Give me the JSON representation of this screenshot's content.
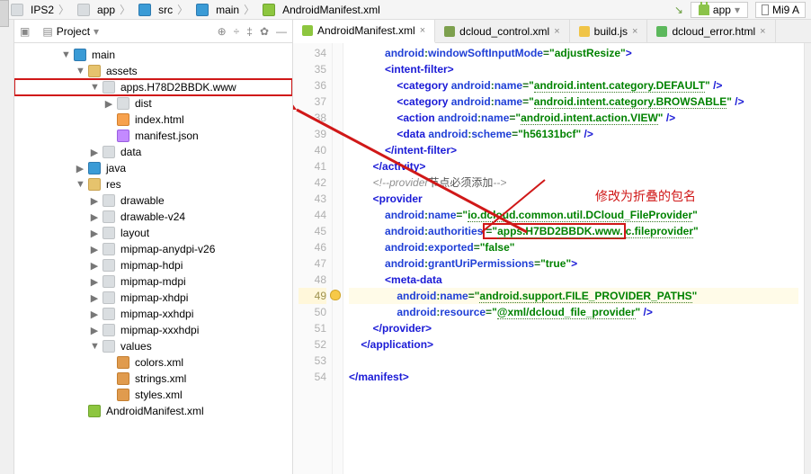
{
  "breadcrumb": [
    "IPS2",
    "app",
    "src",
    "main",
    "AndroidManifest.xml"
  ],
  "breadcrumb_icons": [
    "ico-folder",
    "ico-folder",
    "ico-bluefolder",
    "ico-bluefolder",
    "ico-mf"
  ],
  "topbar": {
    "run_config": "app",
    "device": "Mi9 A"
  },
  "project": {
    "title": "Project",
    "tree": [
      {
        "indent": 3,
        "arrow": "▼",
        "ico": "ico-bluefolder",
        "label": "main",
        "hl": false
      },
      {
        "indent": 4,
        "arrow": "▼",
        "ico": "ico-yellowfolder",
        "label": "assets",
        "hl": false
      },
      {
        "indent": 5,
        "arrow": "▼",
        "ico": "ico-greyfolder",
        "label": "apps.H78D2BBDK.www",
        "hl": true
      },
      {
        "indent": 6,
        "arrow": "▶",
        "ico": "ico-greyfolder",
        "label": "dist",
        "hl": false
      },
      {
        "indent": 6,
        "arrow": "",
        "ico": "ico-html",
        "label": "index.html",
        "hl": false
      },
      {
        "indent": 6,
        "arrow": "",
        "ico": "ico-json",
        "label": "manifest.json",
        "hl": false
      },
      {
        "indent": 5,
        "arrow": "▶",
        "ico": "ico-greyfolder",
        "label": "data",
        "hl": false
      },
      {
        "indent": 4,
        "arrow": "▶",
        "ico": "ico-bluefolder",
        "label": "java",
        "hl": false
      },
      {
        "indent": 4,
        "arrow": "▼",
        "ico": "ico-yellowfolder",
        "label": "res",
        "hl": false
      },
      {
        "indent": 5,
        "arrow": "▶",
        "ico": "ico-greyfolder",
        "label": "drawable",
        "hl": false
      },
      {
        "indent": 5,
        "arrow": "▶",
        "ico": "ico-greyfolder",
        "label": "drawable-v24",
        "hl": false
      },
      {
        "indent": 5,
        "arrow": "▶",
        "ico": "ico-greyfolder",
        "label": "layout",
        "hl": false
      },
      {
        "indent": 5,
        "arrow": "▶",
        "ico": "ico-greyfolder",
        "label": "mipmap-anydpi-v26",
        "hl": false
      },
      {
        "indent": 5,
        "arrow": "▶",
        "ico": "ico-greyfolder",
        "label": "mipmap-hdpi",
        "hl": false
      },
      {
        "indent": 5,
        "arrow": "▶",
        "ico": "ico-greyfolder",
        "label": "mipmap-mdpi",
        "hl": false
      },
      {
        "indent": 5,
        "arrow": "▶",
        "ico": "ico-greyfolder",
        "label": "mipmap-xhdpi",
        "hl": false
      },
      {
        "indent": 5,
        "arrow": "▶",
        "ico": "ico-greyfolder",
        "label": "mipmap-xxhdpi",
        "hl": false
      },
      {
        "indent": 5,
        "arrow": "▶",
        "ico": "ico-greyfolder",
        "label": "mipmap-xxxhdpi",
        "hl": false
      },
      {
        "indent": 5,
        "arrow": "▼",
        "ico": "ico-greyfolder",
        "label": "values",
        "hl": false
      },
      {
        "indent": 6,
        "arrow": "",
        "ico": "ico-xml",
        "label": "colors.xml",
        "hl": false
      },
      {
        "indent": 6,
        "arrow": "",
        "ico": "ico-xml",
        "label": "strings.xml",
        "hl": false
      },
      {
        "indent": 6,
        "arrow": "",
        "ico": "ico-xml",
        "label": "styles.xml",
        "hl": false
      },
      {
        "indent": 4,
        "arrow": "",
        "ico": "ico-mf",
        "label": "AndroidManifest.xml",
        "hl": false
      }
    ]
  },
  "tabs": [
    {
      "label": "AndroidManifest.xml",
      "ico": "ti-mf",
      "active": true
    },
    {
      "label": "dcloud_control.xml",
      "ico": "ti-xml",
      "active": false
    },
    {
      "label": "build.js",
      "ico": "ti-js",
      "active": false
    },
    {
      "label": "dcloud_error.html",
      "ico": "ti-html",
      "active": false
    }
  ],
  "annot_text": "修改为折叠的包名",
  "comment_text": "节点必须添加",
  "authorities_value": "apps.H7BD2BBDK.www.",
  "authorities_suffix": "c.fileprovider",
  "gutter": {
    "start": 34,
    "end": 54,
    "highlight": 49
  }
}
